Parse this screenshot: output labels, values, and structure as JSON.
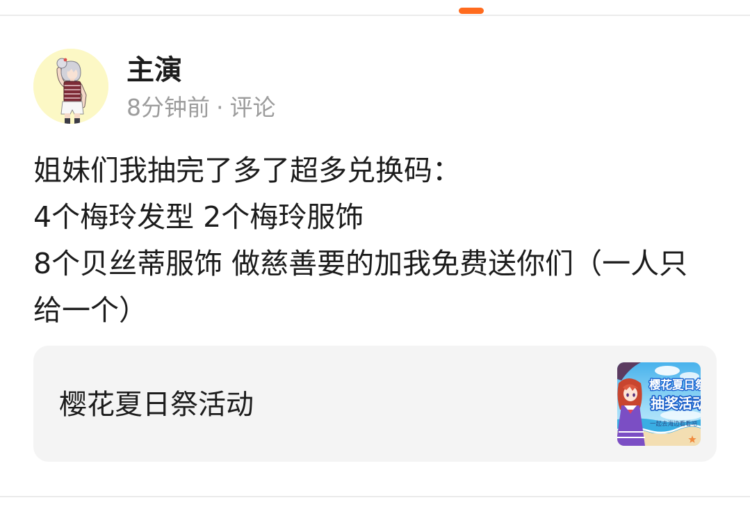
{
  "colors": {
    "accent": "#ff6b1e",
    "text_primary": "#1c1c1c",
    "text_secondary": "#9c9c9c",
    "card_background": "#f4f4f4",
    "divider": "#ebebeb",
    "avatar_background": "#fcf8c5"
  },
  "post": {
    "author": {
      "name": "主演"
    },
    "meta": {
      "time": "8分钟前",
      "separator": "·",
      "action": "评论"
    },
    "content": {
      "lines": [
        "姐妹们我抽完了多了超多兑换码：",
        "4个梅玲发型 2个梅玲服饰",
        "8个贝丝蒂服饰 做慈善要的加我免费送你们（一人只",
        "给一个）"
      ]
    },
    "link_card": {
      "title": "樱花夏日祭活动",
      "thumbnail": {
        "headline": "樱花夏日祭",
        "subheadline": "抽奖活动",
        "tagline": "一起去海边看看吧"
      }
    }
  }
}
